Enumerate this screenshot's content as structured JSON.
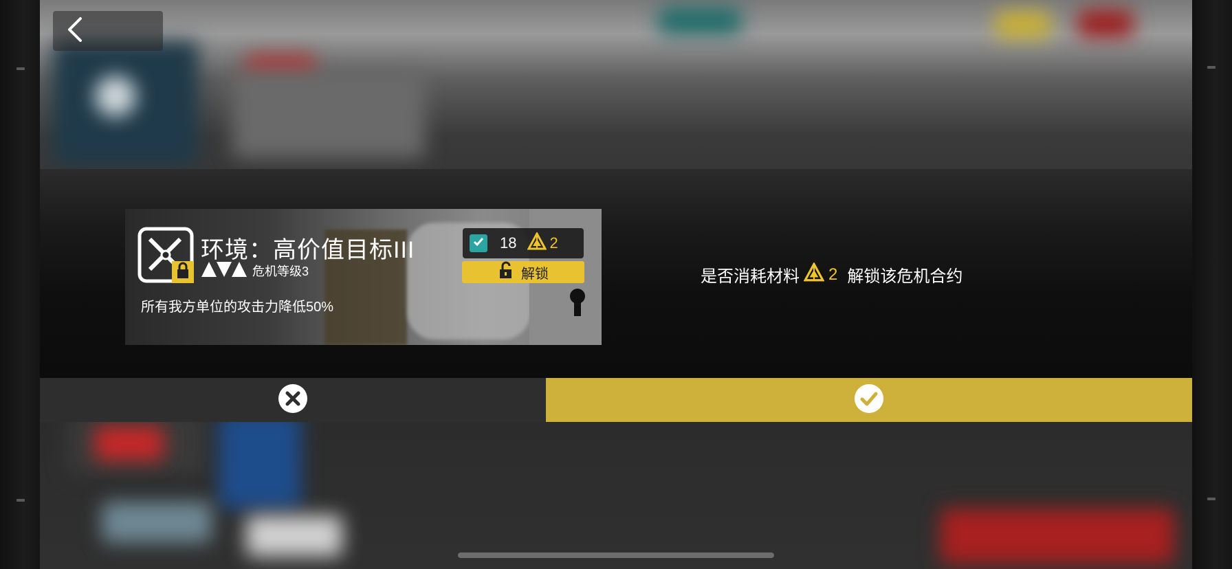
{
  "header": {
    "back_icon": "chevron-left-icon"
  },
  "card": {
    "title": "环境：高价值目标III",
    "danger_label": "危机等级3",
    "danger_icon_count": 3,
    "description": "所有我方单位的攻击力降低50%",
    "cost_count": "18",
    "material_count": "2",
    "unlock_label": "解锁",
    "icon": "sword-cross-lock-icon"
  },
  "confirm": {
    "text_before": "是否消耗材料",
    "material_count": "2",
    "text_after": "解锁该危机合约"
  },
  "buttons": {
    "cancel_icon": "close-icon",
    "confirm_icon": "check-icon"
  },
  "colors": {
    "accent_yellow": "#cdb13a",
    "unlock_yellow": "#e8c230",
    "material_gold": "#f0c52c",
    "checkbox_teal": "#2aa5a1",
    "cancel_bar": "#2e2e2e"
  }
}
